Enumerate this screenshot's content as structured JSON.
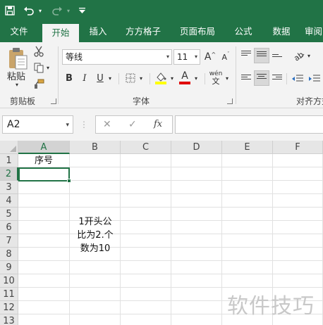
{
  "qat": {
    "save_icon": "save-icon",
    "undo_icon": "undo-icon",
    "redo_icon": "redo-icon",
    "customize_icon": "customize-qat-icon"
  },
  "tabs": [
    "文件",
    "开始",
    "插入",
    "方方格子",
    "页面布局",
    "公式",
    "数据",
    "审阅"
  ],
  "active_tab": "开始",
  "ribbon": {
    "clipboard": {
      "paste_label": "粘贴",
      "group_label": "剪贴板"
    },
    "font": {
      "font_name": "等线",
      "font_size": "11",
      "bold": "B",
      "italic": "I",
      "underline": "U",
      "grow": "A",
      "shrink": "A",
      "font_color_letter": "A",
      "phonetic": "wén",
      "group_label": "字体"
    },
    "alignment": {
      "group_label": "对齐方式"
    }
  },
  "formula_bar": {
    "name_box": "A2",
    "cancel_glyph": "✕",
    "enter_glyph": "✓",
    "fx_label": "fx",
    "formula_value": ""
  },
  "sheet": {
    "columns": [
      "A",
      "B",
      "C",
      "D",
      "E",
      "F"
    ],
    "rows": [
      "1",
      "2",
      "3",
      "4",
      "5",
      "6",
      "7",
      "8",
      "9",
      "10",
      "11",
      "12",
      "13"
    ],
    "selected_cell": "A2",
    "cells": {
      "A1": "序号"
    },
    "note_text": "1开头公\n比为2.个\n数为10"
  },
  "watermark": "软件技巧",
  "colors": {
    "accent": "#217346",
    "ribbon_bg": "#f3f3f3",
    "header_bg": "#e6e6e6"
  }
}
